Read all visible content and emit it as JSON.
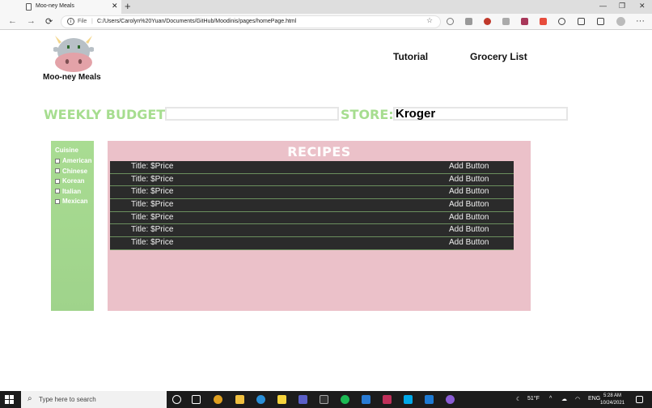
{
  "browser": {
    "tab_title": "Moo-ney Meals",
    "tab_close": "✕",
    "new_tab": "+",
    "file_label": "File",
    "address": "C:/Users/Carolyn%20Yuan/Documents/GitHub/Moodinis/pages/homePage.html",
    "window_controls": [
      "—",
      "❐",
      "✕"
    ]
  },
  "page": {
    "brand": "Moo-ney Meals",
    "nav": [
      "Tutorial",
      "Grocery List"
    ],
    "budget_label": "WEEKLY BUDGET:",
    "budget_value": "",
    "store_label": "STORE:",
    "store_value": "Kroger",
    "sidebar": {
      "heading": "Cuisine",
      "options": [
        "American",
        "Chinese",
        "Korean",
        "Italian",
        "Mexican"
      ]
    },
    "recipes": {
      "title": "RECIPES",
      "rows": [
        {
          "title": "Title: $Price",
          "button": "Add Button"
        },
        {
          "title": "Title: $Price",
          "button": "Add Button"
        },
        {
          "title": "Title: $Price",
          "button": "Add Button"
        },
        {
          "title": "Title: $Price",
          "button": "Add Button"
        },
        {
          "title": "Title: $Price",
          "button": "Add Button"
        },
        {
          "title": "Title: $Price",
          "button": "Add Button"
        },
        {
          "title": "Title: $Price",
          "button": "Add Button"
        }
      ]
    }
  },
  "taskbar": {
    "search_placeholder": "Type here to search",
    "temperature": "51°F",
    "language": "ENG",
    "time": "5:28 AM",
    "date": "10/24/2021"
  },
  "colors": {
    "green_label": "#a6dd8f",
    "sidebar_green": "#a9dc92",
    "recipes_pink": "#ebc1c9",
    "row_dark": "#2b2b2b"
  }
}
